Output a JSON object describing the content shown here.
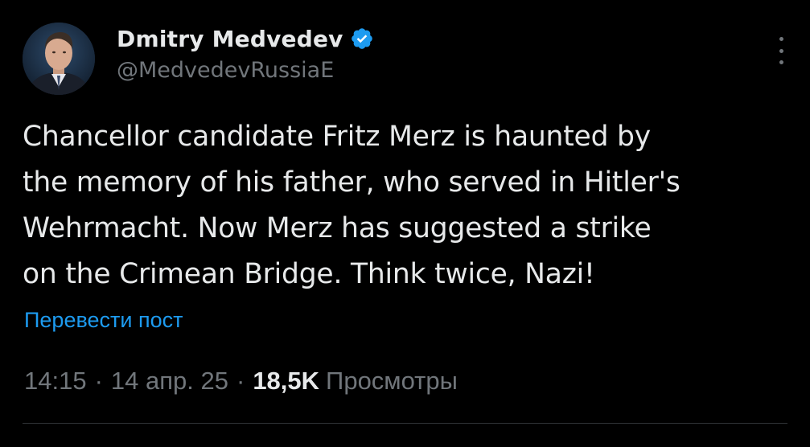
{
  "author": {
    "display_name": "Dmitry Medvedev",
    "handle": "@MedvedevRussiaE",
    "verified_icon": "verified-badge-icon",
    "verified_color": "#1d9bf0"
  },
  "more_icon": "more-dots-vertical-icon",
  "tweet": {
    "text": "Chancellor candidate Fritz Merz is haunted by\nthe memory of his father, who served in Hitler's\nWehrmacht. Now Merz has suggested a strike\non the Crimean Bridge. Think twice, Nazi!"
  },
  "translate_label": "Перевести пост",
  "meta": {
    "time": "14:15",
    "separator": "·",
    "date": "14 апр. 25",
    "views_count": "18,5K",
    "views_label": "Просмотры"
  },
  "colors": {
    "background": "#000000",
    "text": "#e7e9ea",
    "secondary": "#71767b",
    "link": "#1d9bf0",
    "divider": "#2f3336"
  }
}
